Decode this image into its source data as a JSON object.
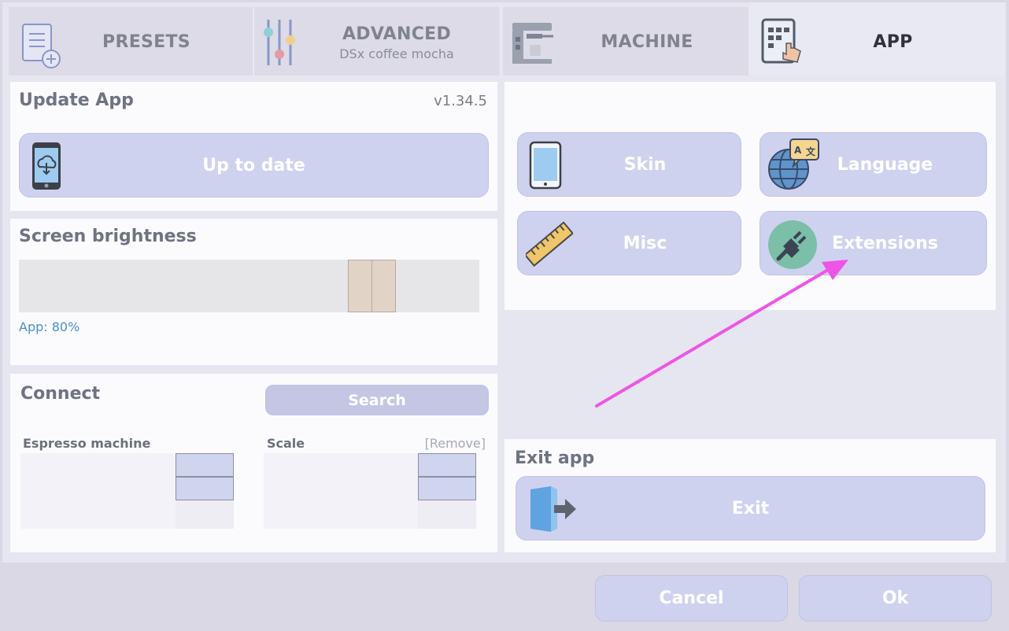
{
  "tabs": [
    {
      "label": "PRESETS",
      "sub": ""
    },
    {
      "label": "ADVANCED",
      "sub": "DSx coffee mocha"
    },
    {
      "label": "MACHINE",
      "sub": ""
    },
    {
      "label": "APP",
      "sub": ""
    }
  ],
  "update": {
    "title": "Update App",
    "version": "v1.34.5",
    "button": "Up to date"
  },
  "brightness": {
    "title": "Screen brightness",
    "status": "App: 80%",
    "value_percent": 80
  },
  "connect": {
    "title": "Connect",
    "search": "Search",
    "espresso_label": "Espresso machine",
    "scale_label": "Scale",
    "remove": "[Remove]"
  },
  "settings": {
    "skin": "Skin",
    "language": "Language",
    "misc": "Misc",
    "extensions": "Extensions"
  },
  "exit": {
    "title": "Exit app",
    "button": "Exit"
  },
  "footer": {
    "cancel": "Cancel",
    "ok": "Ok"
  },
  "colors": {
    "accent": "#cfd2ef",
    "annotation_arrow": "#ee55e6",
    "link": "#4a8fd0"
  }
}
